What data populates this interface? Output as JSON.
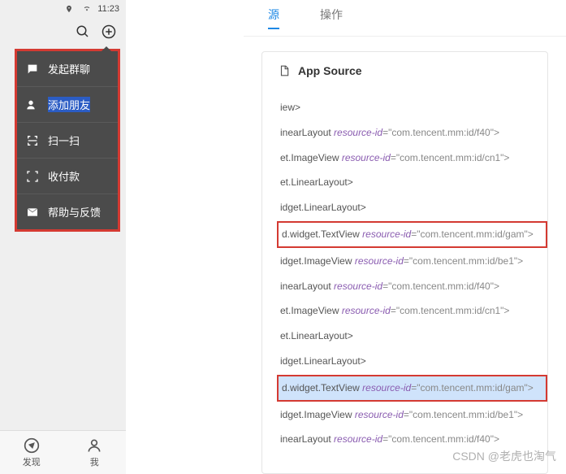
{
  "statusbar": {
    "time": "11:23"
  },
  "popup": {
    "items": [
      {
        "label": "发起群聊"
      },
      {
        "label": "添加朋友",
        "highlight": true
      },
      {
        "label": "扫一扫"
      },
      {
        "label": "收付款"
      },
      {
        "label": "帮助与反馈"
      }
    ]
  },
  "bottomnav": {
    "discover": "发现",
    "me": "我"
  },
  "inspector": {
    "tabs": {
      "source": "源",
      "actions": "操作"
    },
    "panel_title": "App Source",
    "nodes": [
      {
        "tag": "iew>",
        "attr": "",
        "val": ""
      },
      {
        "tag": "inearLayout ",
        "attr": "resource-id",
        "val": "\"com.tencent.mm:id/f40\">"
      },
      {
        "tag": "et.ImageView ",
        "attr": "resource-id",
        "val": "\"com.tencent.mm:id/cn1\">"
      },
      {
        "tag": "et.LinearLayout>",
        "attr": "",
        "val": ""
      },
      {
        "tag": "idget.LinearLayout>",
        "attr": "",
        "val": ""
      },
      {
        "tag": "d.widget.TextView ",
        "attr": "resource-id",
        "val": "\"com.tencent.mm:id/gam\">",
        "box": "red"
      },
      {
        "tag": "idget.ImageView ",
        "attr": "resource-id",
        "val": "\"com.tencent.mm:id/be1\">"
      },
      {
        "tag": "inearLayout ",
        "attr": "resource-id",
        "val": "\"com.tencent.mm:id/f40\">"
      },
      {
        "tag": "et.ImageView ",
        "attr": "resource-id",
        "val": "\"com.tencent.mm:id/cn1\">"
      },
      {
        "tag": "et.LinearLayout>",
        "attr": "",
        "val": ""
      },
      {
        "tag": "idget.LinearLayout>",
        "attr": "",
        "val": ""
      },
      {
        "tag": "d.widget.TextView ",
        "attr": "resource-id",
        "val": "\"com.tencent.mm:id/gam\">",
        "box": "redblue"
      },
      {
        "tag": "idget.ImageView ",
        "attr": "resource-id",
        "val": "\"com.tencent.mm:id/be1\">"
      },
      {
        "tag": "inearLayout ",
        "attr": "resource-id",
        "val": "\"com.tencent.mm:id/f40\">"
      }
    ]
  },
  "watermark": "CSDN @老虎也淘气"
}
